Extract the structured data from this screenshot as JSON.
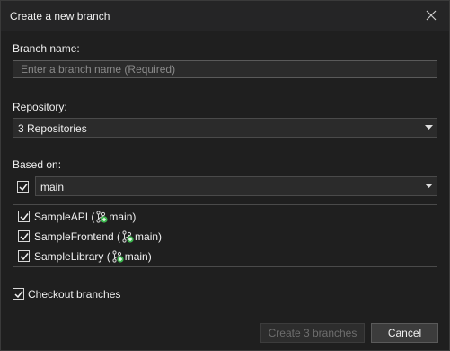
{
  "dialog": {
    "title": "Create a new branch",
    "close_icon": "close-icon"
  },
  "branch_name": {
    "label": "Branch name:",
    "value": "",
    "placeholder": "Enter a branch name (Required)"
  },
  "repository": {
    "label": "Repository:",
    "selected": "3 Repositories"
  },
  "based_on": {
    "label": "Based on:",
    "checked": true,
    "selected": "main"
  },
  "repositories": [
    {
      "name": "SampleAPI",
      "branch": "main",
      "checked": true,
      "prefix": "SampleAPI (",
      "suffix": "main)"
    },
    {
      "name": "SampleFrontend",
      "branch": "main",
      "checked": true,
      "prefix": "SampleFrontend (",
      "suffix": "main)"
    },
    {
      "name": "SampleLibrary",
      "branch": "main",
      "checked": true,
      "prefix": "SampleLibrary (",
      "suffix": "main)"
    }
  ],
  "checkout": {
    "label": "Checkout branches",
    "checked": true
  },
  "buttons": {
    "create": "Create 3 branches",
    "cancel": "Cancel"
  },
  "colors": {
    "background": "#1f1f1f",
    "branch_icon_accent": "#3fb950"
  }
}
